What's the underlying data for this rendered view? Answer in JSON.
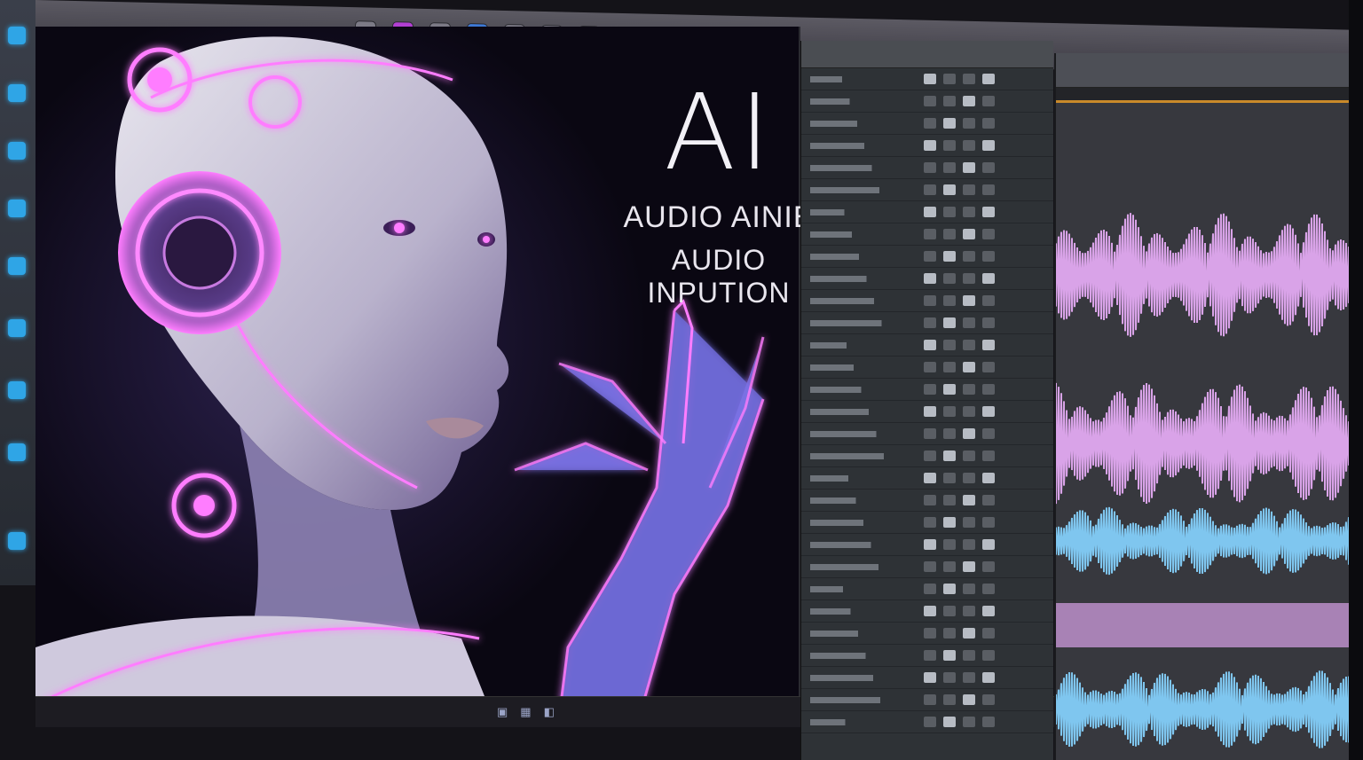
{
  "headline": {
    "title": "AI",
    "line1": "AUDIO AINIE",
    "line2": "AUDIO INPUTION"
  },
  "colors": {
    "accent_pink": "#e27df0",
    "waveform_pink": "#d9a3e8",
    "waveform_blue": "#7fc6ef",
    "timeline_orange": "#c98a2a"
  },
  "icons": {
    "toolbar": [
      "record-icon",
      "loop-icon",
      "metronome-icon",
      "mixer-icon",
      "settings-icon"
    ],
    "sidebar": [
      "folder-icon",
      "track-icon",
      "effects-icon",
      "plugin-icon",
      "browser-icon"
    ]
  }
}
